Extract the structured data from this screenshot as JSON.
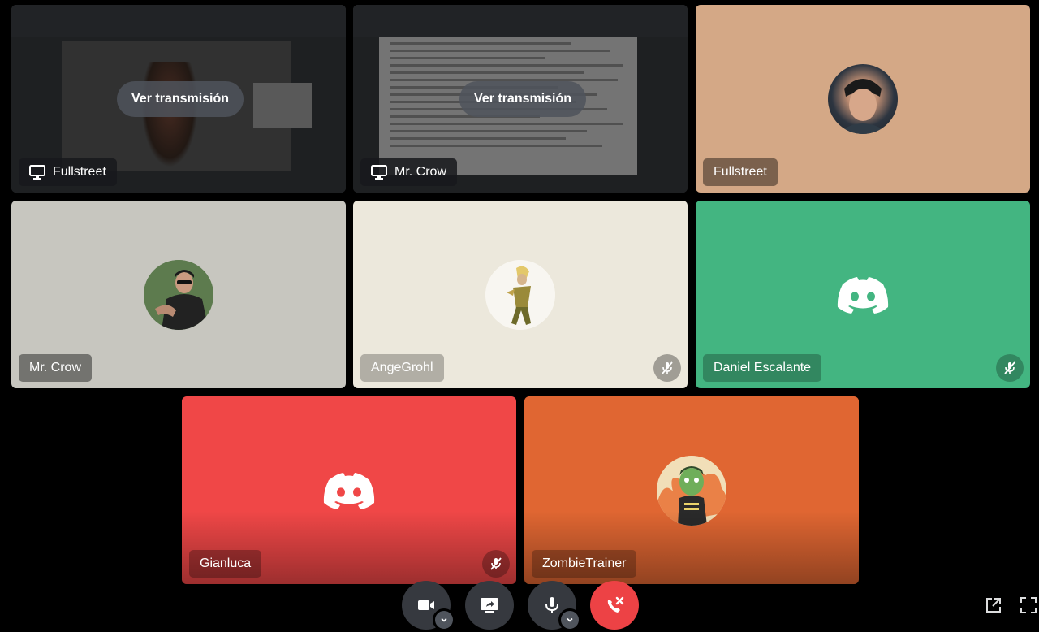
{
  "tiles": [
    {
      "name": "Fullstreet",
      "type": "stream",
      "watch_label": "Ver transmisión"
    },
    {
      "name": "Mr. Crow",
      "type": "stream",
      "watch_label": "Ver transmisión"
    },
    {
      "name": "Fullstreet",
      "type": "avatar",
      "bg": "#d4a886",
      "muted": false
    },
    {
      "name": "Mr. Crow",
      "type": "avatar",
      "bg": "#c7c6bf",
      "muted": false
    },
    {
      "name": "AngeGrohl",
      "type": "avatar",
      "bg": "#ece8dc",
      "muted": true
    },
    {
      "name": "Daniel Escalante",
      "type": "discord-default",
      "bg": "#43b581",
      "muted": true
    },
    {
      "name": "Gianluca",
      "type": "discord-default",
      "bg": "#f04747",
      "muted": true
    },
    {
      "name": "ZombieTrainer",
      "type": "avatar",
      "bg": "#e06632",
      "muted": false
    }
  ],
  "controls": [
    {
      "icon": "camera-icon",
      "has_menu": true
    },
    {
      "icon": "screen-share-icon",
      "has_menu": false
    },
    {
      "icon": "microphone-icon",
      "has_menu": true
    },
    {
      "icon": "disconnect-icon",
      "has_menu": false
    }
  ],
  "corner_controls": [
    {
      "icon": "popout-icon"
    },
    {
      "icon": "fullscreen-icon"
    }
  ],
  "colors": {
    "disconnect": "#ed4245",
    "control_bg": "#36393f"
  }
}
